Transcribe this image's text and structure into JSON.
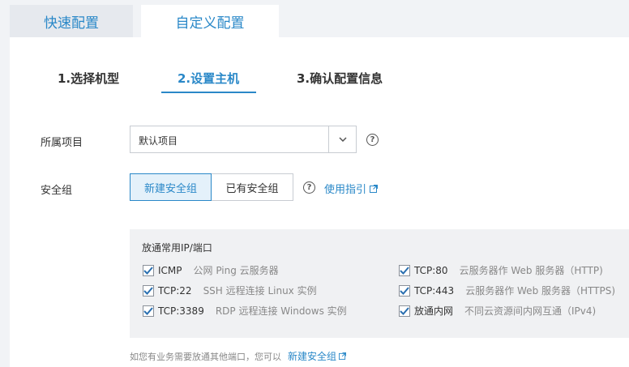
{
  "tabs": {
    "quick": "快速配置",
    "custom": "自定义配置"
  },
  "steps": [
    "1.选择机型",
    "2.设置主机",
    "3.确认配置信息"
  ],
  "project": {
    "label": "所属项目",
    "value": "默认项目"
  },
  "security_group": {
    "label": "安全组",
    "new_label": "新建安全组",
    "existing_label": "已有安全组",
    "guide_label": "使用指引"
  },
  "ports": {
    "title": "放通常用IP/端口",
    "items": [
      {
        "name": "ICMP",
        "desc": "公网 Ping 云服务器",
        "checked": true
      },
      {
        "name": "TCP:22",
        "desc": "SSH 远程连接 Linux 实例",
        "checked": true
      },
      {
        "name": "TCP:3389",
        "desc": "RDP 远程连接 Windows 实例",
        "checked": true
      },
      {
        "name": "TCP:80",
        "desc": "云服务器作 Web 服务器（HTTP)",
        "checked": true
      },
      {
        "name": "TCP:443",
        "desc": "云服务器作 Web 服务器（HTTPS)",
        "checked": true
      },
      {
        "name": "放通内网",
        "desc": "不同云资源间内网互通（IPv4)",
        "checked": true
      }
    ]
  },
  "hint": {
    "text": "如您有业务需要放通其他端口，您可以",
    "link": "新建安全组"
  },
  "colors": {
    "accent": "#2a88c8",
    "panel_bg": "#ffffff",
    "page_bg": "#f1f3f6"
  }
}
